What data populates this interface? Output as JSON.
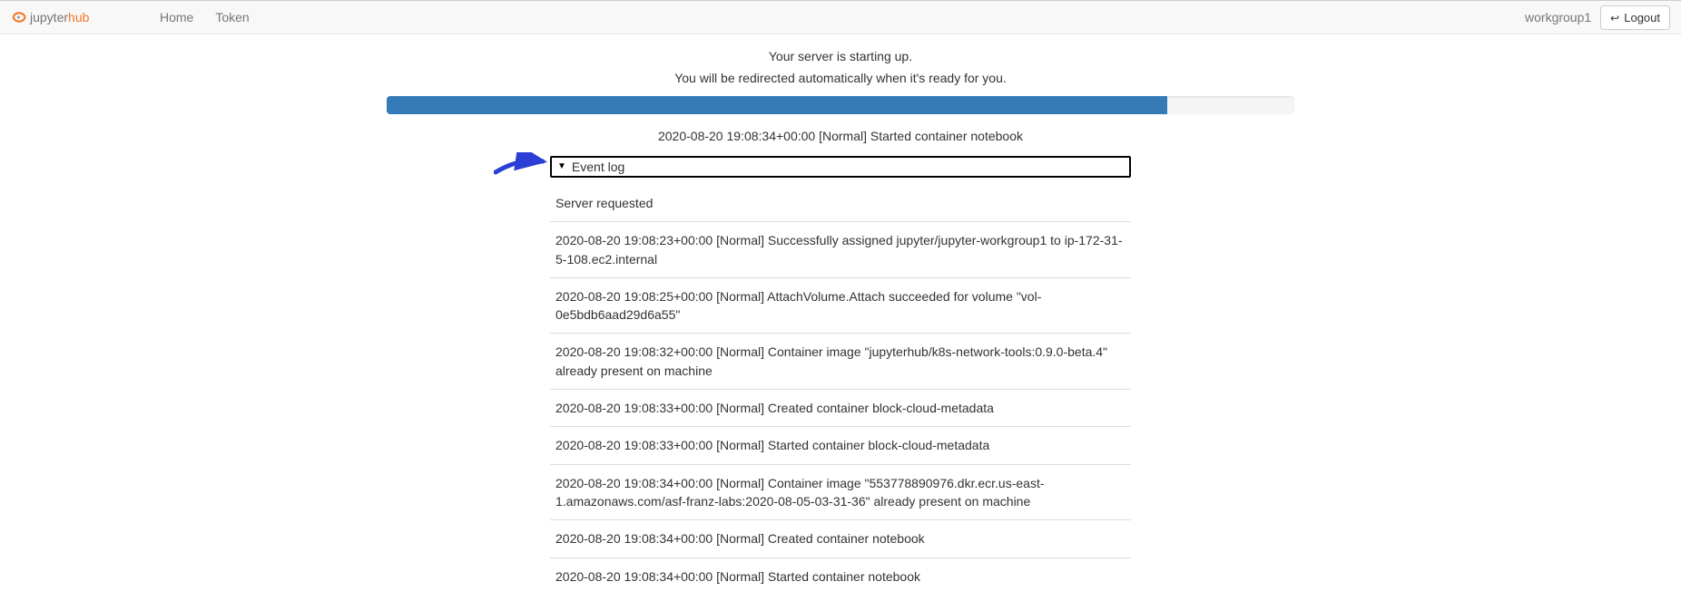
{
  "nav": {
    "home": "Home",
    "token": "Token",
    "username": "workgroup1",
    "logout": "Logout"
  },
  "status": {
    "line1": "Your server is starting up.",
    "line2": "You will be redirected automatically when it's ready for you.",
    "progress_percent": 86
  },
  "last_event": "2020-08-20 19:08:34+00:00 [Normal] Started container notebook",
  "event_log": {
    "summary": "Event log",
    "entries": [
      "Server requested",
      "2020-08-20 19:08:23+00:00 [Normal] Successfully assigned jupyter/jupyter-workgroup1 to ip-172-31-5-108.ec2.internal",
      "2020-08-20 19:08:25+00:00 [Normal] AttachVolume.Attach succeeded for volume \"vol-0e5bdb6aad29d6a55\"",
      "2020-08-20 19:08:32+00:00 [Normal] Container image \"jupyterhub/k8s-network-tools:0.9.0-beta.4\" already present on machine",
      "2020-08-20 19:08:33+00:00 [Normal] Created container block-cloud-metadata",
      "2020-08-20 19:08:33+00:00 [Normal] Started container block-cloud-metadata",
      "2020-08-20 19:08:34+00:00 [Normal] Container image \"553778890976.dkr.ecr.us-east-1.amazonaws.com/asf-franz-labs:2020-08-05-03-31-36\" already present on machine",
      "2020-08-20 19:08:34+00:00 [Normal] Created container notebook",
      "2020-08-20 19:08:34+00:00 [Normal] Started container notebook"
    ]
  }
}
